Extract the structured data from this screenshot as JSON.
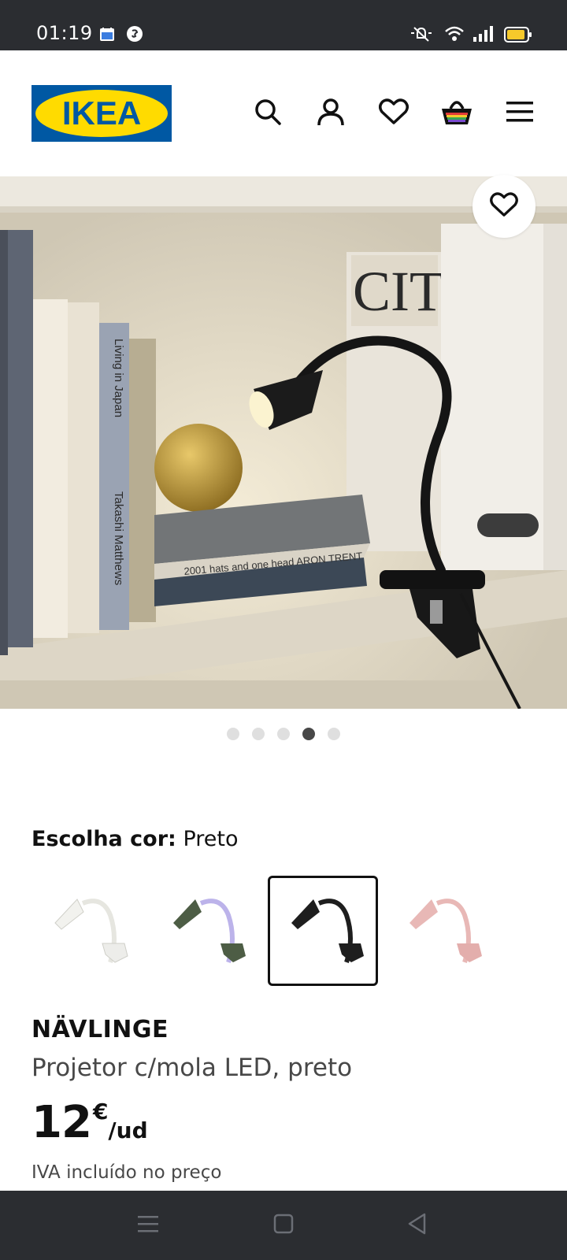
{
  "status_bar": {
    "time": "01:19"
  },
  "header": {
    "logo_text": "IKEA",
    "logo_colors": {
      "blue": "#0058a3",
      "yellow": "#ffdb00"
    },
    "icons": [
      "search-icon",
      "account-icon",
      "heart-icon",
      "basket-icon",
      "menu-icon"
    ]
  },
  "gallery": {
    "slide_count": 5,
    "active_index": 3
  },
  "color_picker": {
    "label": "Escolha cor:",
    "selected_value": "Preto",
    "options": [
      {
        "name": "white",
        "color": "#f2f2ee"
      },
      {
        "name": "green-lilac",
        "color": "#4d5d45"
      },
      {
        "name": "black",
        "color": "#1e1e1e"
      },
      {
        "name": "pink",
        "color": "#e8b8b6"
      }
    ],
    "selected_index": 2
  },
  "product": {
    "name": "NÄVLINGE",
    "description": "Projetor c/mola LED, preto",
    "price_integer": "12",
    "price_currency": "€",
    "price_unit": "/ud",
    "vat_note": "IVA incluído no preço"
  }
}
